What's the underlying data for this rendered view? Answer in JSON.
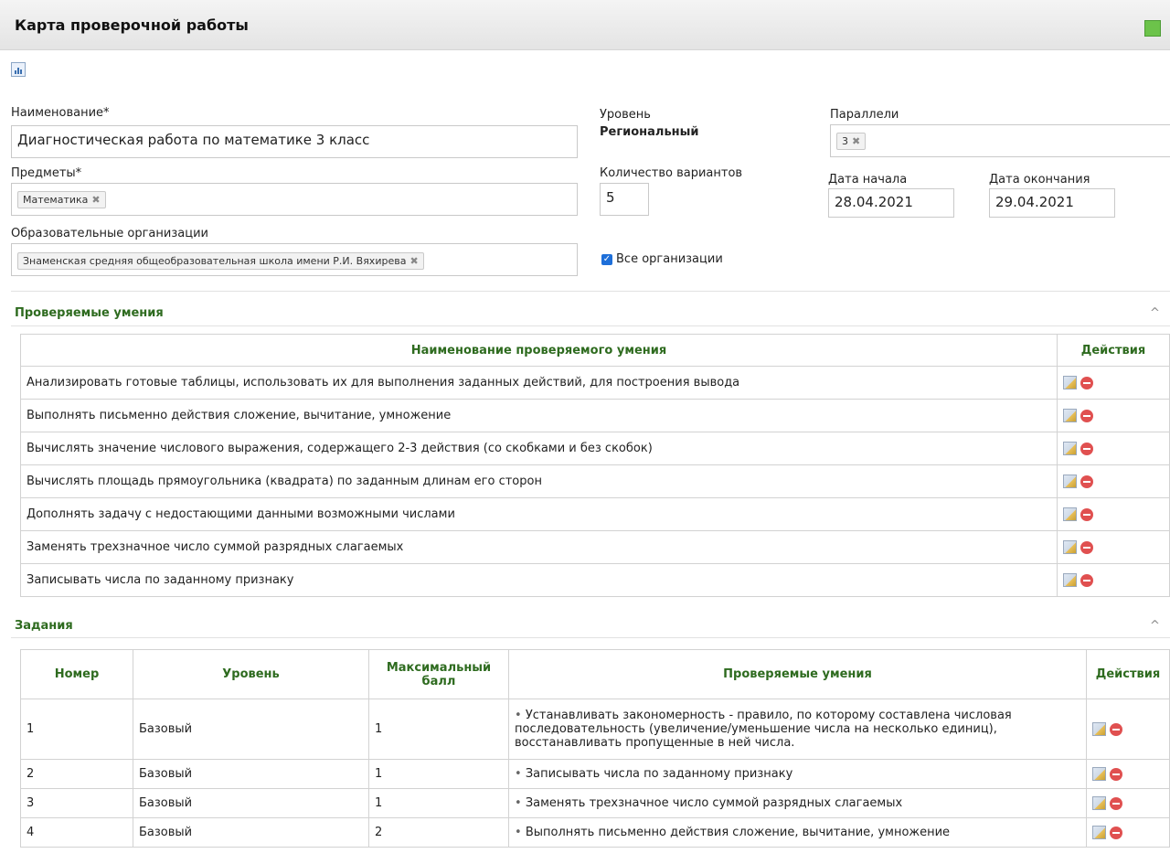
{
  "header": {
    "title": "Карта проверочной работы"
  },
  "form": {
    "name_label": "Наименование*",
    "name_value": "Диагностическая работа по математике 3 класс",
    "subjects_label": "Предметы*",
    "subject_tag": "Математика",
    "orgs_label": "Образовательные организации",
    "org_tag": "Знаменская средняя общеобразовательная школа имени Р.И. Вяхирева",
    "level_label": "Уровень",
    "level_value": "Региональный",
    "variants_label": "Количество вариантов",
    "variants_value": "5",
    "all_orgs_label": "Все организации",
    "all_orgs_checked": true,
    "parallels_label": "Параллели",
    "parallel_tag": "3",
    "start_label": "Дата начала",
    "start_value": "28.04.2021",
    "end_label": "Дата окончания",
    "end_value": "29.04.2021",
    "tag_remove_glyph": "✖"
  },
  "skills": {
    "title": "Проверяемые умения",
    "col_name": "Наименование проверяемого умения",
    "col_actions": "Действия",
    "rows": [
      "Анализировать готовые таблицы, использовать их для выполнения заданных действий, для построения вывода",
      "Выполнять письменно действия сложение, вычитание, умножение",
      "Вычислять значение числового выражения, содержащего 2-3 действия (со скобками и без скобок)",
      "Вычислять площадь прямоугольника (квадрата) по заданным длинам его сторон",
      "Дополнять задачу с недостающими данными возможными числами",
      "Заменять трехзначное число суммой разрядных слагаемых",
      "Записывать числа по заданному признаку"
    ]
  },
  "tasks": {
    "title": "Задания",
    "col_number": "Номер",
    "col_level": "Уровень",
    "col_max": "Максимальный балл",
    "col_skills": "Проверяемые умения",
    "col_actions": "Действия",
    "rows": [
      {
        "number": "1",
        "level": "Базовый",
        "max": "1",
        "skill": "Устанавливать закономерность - правило, по которому составлена числовая последовательность (увеличение/уменьшение числа на несколько единиц), восстанавливать пропущенные в ней числа."
      },
      {
        "number": "2",
        "level": "Базовый",
        "max": "1",
        "skill": "Записывать числа по заданному признаку"
      },
      {
        "number": "3",
        "level": "Базовый",
        "max": "1",
        "skill": "Заменять трехзначное число суммой разрядных слагаемых"
      },
      {
        "number": "4",
        "level": "Базовый",
        "max": "2",
        "skill": "Выполнять письменно действия сложение, вычитание, умножение"
      }
    ]
  },
  "ui": {
    "collapse_glyph": "^",
    "bullet_glyph": "•",
    "check_glyph": "✓"
  }
}
